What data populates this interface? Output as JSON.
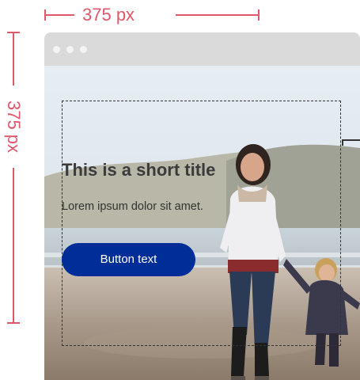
{
  "dimensions": {
    "width_label": "375 px",
    "height_label": "375 px"
  },
  "content": {
    "title": "This is a short title",
    "body": "Lorem ipsum dolor sit amet.",
    "button_label": "Button text"
  },
  "colors": {
    "annotation": "#e0566a",
    "button": "#002e99",
    "browser_bar": "#dadada"
  }
}
